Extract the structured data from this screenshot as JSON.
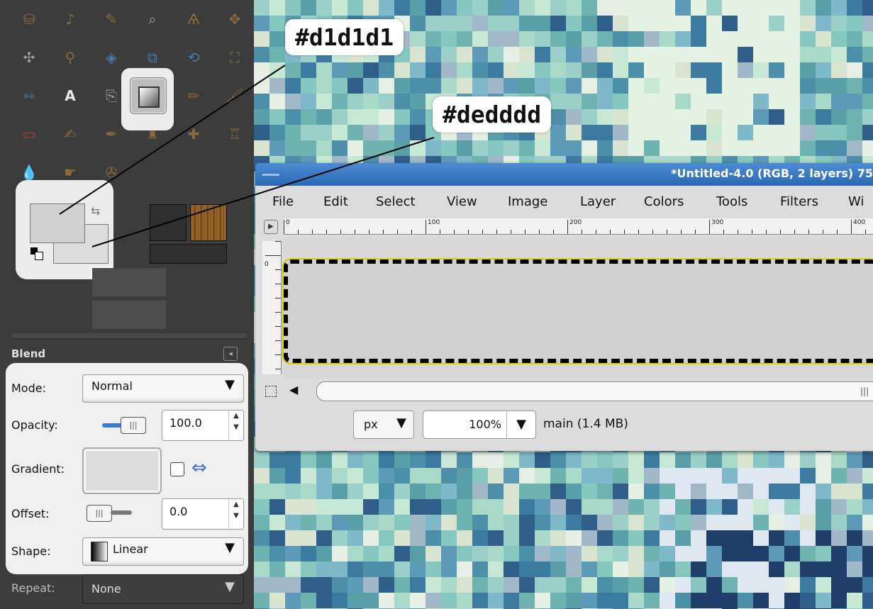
{
  "annotations": {
    "fg_color": "#d1d1d1",
    "bg_color": "#dedddd"
  },
  "toolbox": {
    "tool_icons": [
      "paint-bucket",
      "lasso",
      "color-picker",
      "magnifier",
      "paths",
      "move",
      "align",
      "free-select",
      "perspective",
      "crop",
      "rotate",
      "scale",
      "flip",
      "text",
      "clone",
      "blend",
      "pencil",
      "paintbrush",
      "eraser",
      "airbrush",
      "ink",
      "clone-stamp",
      "heal",
      "perspective-clone",
      "blur",
      "smudge",
      "dodge-burn"
    ],
    "foreground_color": "#d1d1d1",
    "background_color": "#dedddd",
    "tool_options_title": "Blend"
  },
  "options": {
    "mode_label": "Mode:",
    "mode_value": "Normal",
    "opacity_label": "Opacity:",
    "opacity_value": "100.0",
    "opacity_fraction": 1.0,
    "gradient_label": "Gradient:",
    "offset_label": "Offset:",
    "offset_value": "0.0",
    "shape_label": "Shape:",
    "shape_value": "Linear",
    "repeat_label": "Repeat:",
    "repeat_value": "None"
  },
  "window": {
    "title": "*Untitled-4.0 (RGB, 2 layers) 75",
    "menu": [
      "File",
      "Edit",
      "Select",
      "View",
      "Image",
      "Layer",
      "Colors",
      "Tools",
      "Filters",
      "Wi"
    ],
    "ruler_marks": [
      "0",
      "100",
      "200",
      "300",
      "400"
    ],
    "vruler_mark": "0",
    "unit": "px",
    "zoom": "100%",
    "status": "main (1.4 MB)",
    "accent_color": "#3a7bd0"
  }
}
